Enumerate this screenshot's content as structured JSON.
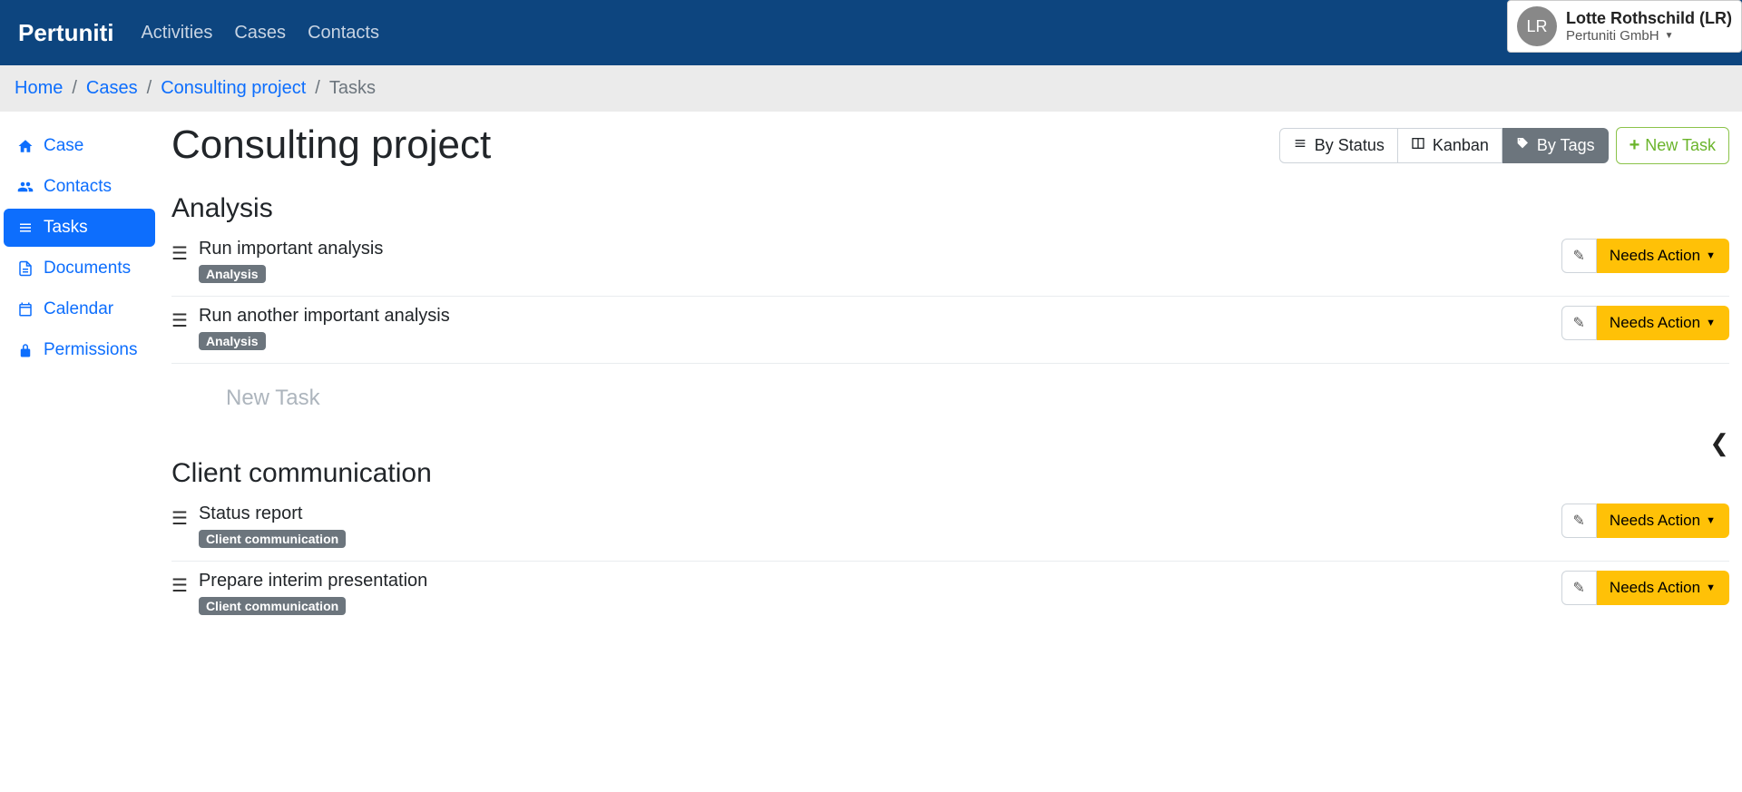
{
  "navbar": {
    "brand": "Pertuniti",
    "links": [
      "Activities",
      "Cases",
      "Contacts"
    ],
    "user": {
      "initials": "LR",
      "name": "Lotte Rothschild (LR)",
      "org": "Pertuniti GmbH"
    }
  },
  "breadcrumbs": {
    "items": [
      "Home",
      "Cases",
      "Consulting project"
    ],
    "current": "Tasks"
  },
  "sidebar": {
    "items": [
      {
        "label": "Case"
      },
      {
        "label": "Contacts"
      },
      {
        "label": "Tasks"
      },
      {
        "label": "Documents"
      },
      {
        "label": "Calendar"
      },
      {
        "label": "Permissions"
      }
    ],
    "active_index": 2
  },
  "page": {
    "title": "Consulting project",
    "views": {
      "by_status": "By Status",
      "kanban": "Kanban",
      "by_tags": "By Tags",
      "active": "by_tags"
    },
    "new_task_button": "New Task",
    "new_task_placeholder": "New Task",
    "status_label": "Needs Action",
    "sections": [
      {
        "title": "Analysis",
        "tasks": [
          {
            "title": "Run important analysis",
            "tag": "Analysis"
          },
          {
            "title": "Run another important analysis",
            "tag": "Analysis"
          }
        ]
      },
      {
        "title": "Client communication",
        "tasks": [
          {
            "title": "Status report",
            "tag": "Client communication"
          },
          {
            "title": "Prepare interim presentation",
            "tag": "Client communication"
          }
        ]
      }
    ]
  }
}
